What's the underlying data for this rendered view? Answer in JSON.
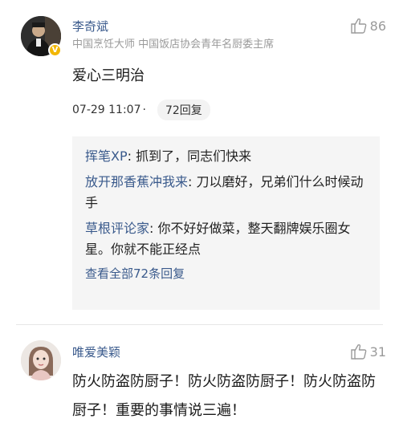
{
  "comments": [
    {
      "author": "李奇斌",
      "title": "中国烹饪大师 中国饭店协会青年名厨委主席",
      "likes": "86",
      "text": "爱心三明治",
      "timestamp": "07-29 11:07",
      "dot": "·",
      "reply_count_label": "72回复",
      "replies": [
        {
          "name": "挥笔XP",
          "text": ": 抓到了，同志们快来"
        },
        {
          "name": "放开那香蕉冲我来",
          "text": ": 刀以磨好，兄弟们什么时候动手"
        },
        {
          "name": "草根评论家",
          "text": ": 你不好好做菜，整天翻牌娱乐圈女星。你就不能正经点"
        }
      ],
      "view_all_label": "查看全部72条回复"
    },
    {
      "author": "唯爱美颖",
      "likes": "31",
      "text": "防火防盗防厨子！防火防盗防厨子！防火防盗防厨子！重要的事情说三遍！"
    }
  ],
  "icons": {
    "like": "thumbs-up-icon",
    "verified": "verified-badge-icon"
  },
  "colors": {
    "link": "#3a5a8c",
    "muted": "#9a9a9a",
    "reply_bg": "#f5f5f5",
    "badge": "#f2b705"
  }
}
